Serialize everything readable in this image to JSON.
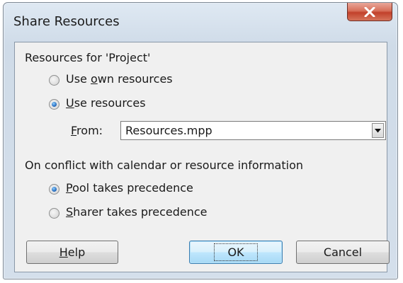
{
  "dialog": {
    "title": "Share Resources",
    "close_icon": "close-icon",
    "resources_group_label": "Resources for 'Project'",
    "option_own_prefix": "Use ",
    "option_own_access": "o",
    "option_own_suffix": "wn resources",
    "option_use_access": "U",
    "option_use_suffix": "se resources",
    "selected_resources_option": "Use resources",
    "from_label_access": "F",
    "from_label_suffix": "rom:",
    "from_value": "Resources.mpp",
    "conflict_label": "On conflict with calendar or resource information",
    "option_pool_access": "P",
    "option_pool_suffix": "ool takes precedence",
    "option_sharer_access": "S",
    "option_sharer_suffix": "harer takes precedence",
    "selected_conflict_option": "Pool takes precedence",
    "help_access": "H",
    "help_suffix": "elp",
    "ok_label": "OK",
    "cancel_label": "Cancel"
  }
}
